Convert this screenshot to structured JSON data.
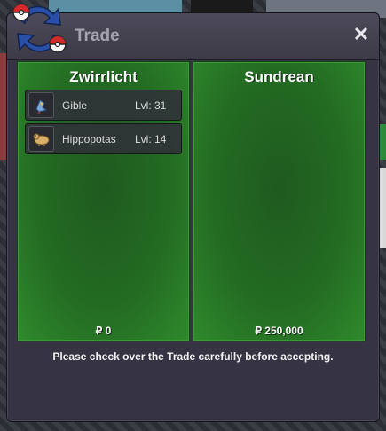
{
  "window": {
    "title": "Trade",
    "close_label": "✕"
  },
  "left_trader": {
    "name": "Zwirrlicht",
    "items": [
      {
        "name": "Gible",
        "level": "Lvl: 31",
        "icon": "gible-icon"
      },
      {
        "name": "Hippopotas",
        "level": "Lvl: 14",
        "icon": "hippopotas-icon"
      }
    ],
    "money": "₽ 0"
  },
  "right_trader": {
    "name": "Sundrean",
    "items": [],
    "money": "₽ 250,000"
  },
  "notice": "Please check over the Trade carefully before accepting.",
  "colors": {
    "panel_green": "#236b22",
    "window_bg": "#363342",
    "accent_red": "#c0283a",
    "accent_blue": "#2a4fa8"
  }
}
